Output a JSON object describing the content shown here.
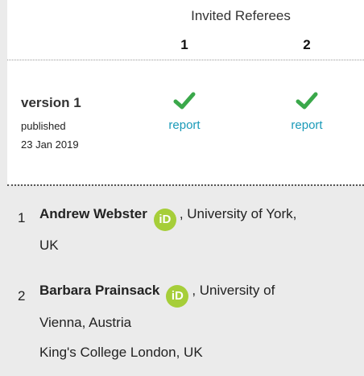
{
  "referees": {
    "title": "Invited Referees",
    "columns": [
      "1",
      "2"
    ]
  },
  "version": {
    "label": "version 1",
    "published_label": "published",
    "date": "23 Jan 2019",
    "reports": [
      {
        "status_icon": "check-icon",
        "link_label": "report"
      },
      {
        "status_icon": "check-icon",
        "link_label": "report"
      }
    ]
  },
  "referee_list": [
    {
      "number": "1",
      "name": "Andrew Webster",
      "orcid_label": "iD",
      "affiliation_line1": ", University of York,",
      "affiliation_line2": "UK"
    },
    {
      "number": "2",
      "name": "Barbara Prainsack",
      "orcid_label": "iD",
      "affiliation_line1": ", University of",
      "affiliation_line2": "Vienna, Austria",
      "affiliation_line3": "King's College London, UK"
    }
  ],
  "colors": {
    "check": "#3aa84a",
    "link": "#1a9ab8",
    "orcid": "#a6ce39",
    "panel_bg": "#ebebeb"
  }
}
